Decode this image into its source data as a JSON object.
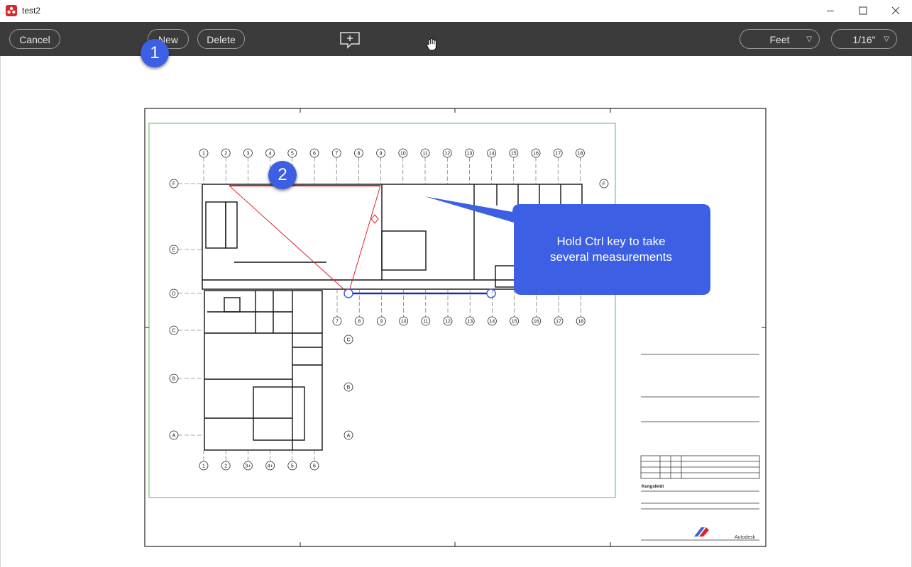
{
  "window": {
    "title": "test2"
  },
  "toolbar": {
    "cancel_label": "Cancel",
    "new_label": "New",
    "delete_label": "Delete",
    "units_value": "Feet",
    "scale_value": "1/16\""
  },
  "annotations": {
    "badge1": "1",
    "badge2": "2",
    "callout_line1": "Hold Ctrl key to take",
    "callout_line2": "several measurements"
  },
  "drawing": {
    "grid_top": [
      "1",
      "2",
      "3",
      "4",
      "5",
      "6",
      "7",
      "8",
      "9",
      "10",
      "11",
      "12",
      "13",
      "14",
      "15",
      "16",
      "17",
      "18"
    ],
    "grid_mid": [
      "7",
      "8",
      "9",
      "10",
      "11",
      "12",
      "13",
      "14",
      "15",
      "16",
      "17",
      "18"
    ],
    "grid_bottom": [
      "1",
      "2",
      "3+",
      "4+",
      "5",
      "6"
    ],
    "grid_left": [
      "F",
      "E",
      "D",
      "C",
      "B",
      "A"
    ],
    "title_block_name": "Kongsfeldt",
    "title_block_brand": "Autodesk"
  },
  "colors": {
    "toolbar_bg": "#3b3b3b",
    "accent_blue": "#3c5fe3",
    "measure_red": "#e0202a",
    "sheet_green": "#4caf50"
  }
}
